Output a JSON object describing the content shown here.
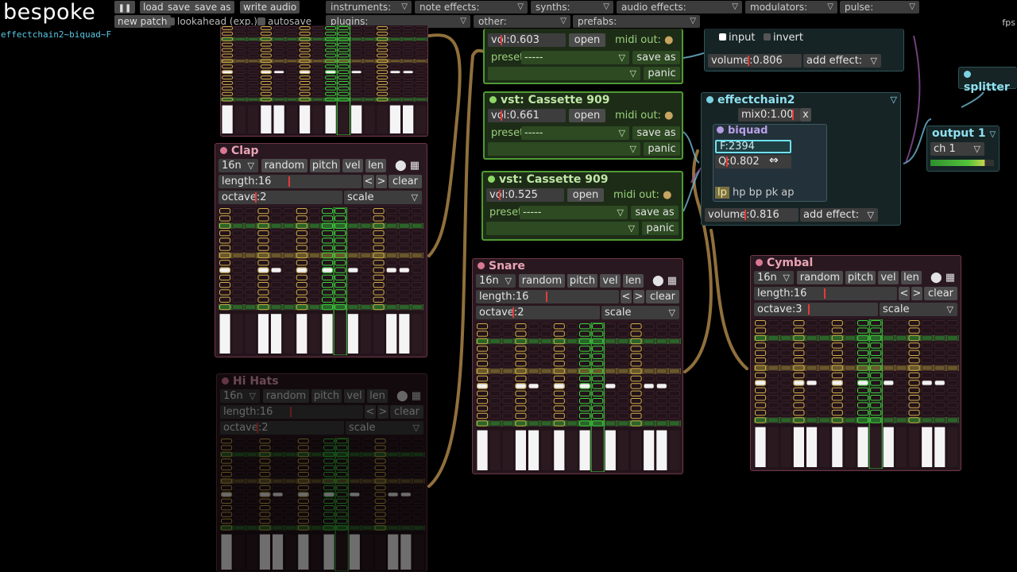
{
  "app": {
    "name": "bespoke",
    "patch_name": "effectchain2~biquad~F",
    "fps_label": "fps"
  },
  "toolbar": {
    "pause_glyph": "❚❚",
    "load": "load",
    "save": "save",
    "save_as": "save as",
    "write_audio": "write audio",
    "new_patch": "new patch",
    "lookahead": "lookahead (exp.)",
    "autosave": "autosave"
  },
  "menus": [
    {
      "label": "instruments:"
    },
    {
      "label": "note effects:"
    },
    {
      "label": "synths:"
    },
    {
      "label": "audio effects:"
    },
    {
      "label": "modulators:"
    },
    {
      "label": "pulse:"
    },
    {
      "label": "plugins:"
    },
    {
      "label": "other:"
    },
    {
      "label": "prefabs:"
    }
  ],
  "vst_top": {
    "vol": "vol:0.603",
    "open": "open",
    "midi_out": "midi out:",
    "preset": "preset",
    "preset_value": "-----",
    "save_as": "save as",
    "panic": "panic"
  },
  "vst1": {
    "title": "vst: Cassette 909",
    "vol": "vol:0.661",
    "open": "open",
    "midi_out": "midi out:",
    "preset": "preset",
    "preset_value": "-----",
    "save_as": "save as",
    "panic": "panic"
  },
  "vst2": {
    "title": "vst: Cassette 909",
    "vol": "vol:0.525",
    "open": "open",
    "midi_out": "midi out:",
    "preset": "preset",
    "preset_value": "-----",
    "save_as": "save as",
    "panic": "panic"
  },
  "fx_top": {
    "input": "input",
    "invert": "invert",
    "volume": "volume:0.806",
    "add_effect": "add effect:"
  },
  "effectchain2": {
    "title": "effectchain2",
    "mix": "mix0:1.00",
    "remove": "x",
    "biquad_title": "biquad",
    "freq": "F:2394",
    "q": "Q:0.802",
    "filters": [
      "lp",
      "hp",
      "bp",
      "pk",
      "ap"
    ],
    "volume": "volume:0.816",
    "add_effect": "add effect:"
  },
  "splitter": {
    "title": "splitter"
  },
  "output": {
    "title": "output 1",
    "channel": "ch 1"
  },
  "clap": {
    "title": "Clap",
    "interval": "16n",
    "random": "random",
    "pitch": "pitch",
    "vel": "vel",
    "len": "len",
    "length": "length:16",
    "prev": "<",
    "next": ">",
    "clear": "clear",
    "octave": "octave:2",
    "scale": "scale"
  },
  "snare": {
    "title": "Snare",
    "interval": "16n",
    "random": "random",
    "pitch": "pitch",
    "vel": "vel",
    "len": "len",
    "length": "length:16",
    "prev": "<",
    "next": ">",
    "clear": "clear",
    "octave": "octave:2",
    "scale": "scale"
  },
  "cymbal": {
    "title": "Cymbal",
    "interval": "16n",
    "random": "random",
    "pitch": "pitch",
    "vel": "vel",
    "len": "len",
    "length": "length:16",
    "prev": "<",
    "next": ">",
    "clear": "clear",
    "octave": "octave:3",
    "scale": "scale"
  },
  "hihats": {
    "title": "Hi Hats",
    "interval": "16n",
    "random": "random",
    "pitch": "pitch",
    "vel": "vel",
    "len": "len",
    "length": "length:16",
    "prev": "<",
    "next": ">",
    "clear": "clear",
    "octave": "octave:2",
    "scale": "scale"
  },
  "colors": {
    "accent_cyan": "#59c9e6",
    "drum_pink": "#d97893",
    "vst_green": "#4f9a33",
    "cable_gold": "#c9a15a",
    "grid_green": "#37c437",
    "grid_yellow": "#d4b24a"
  }
}
